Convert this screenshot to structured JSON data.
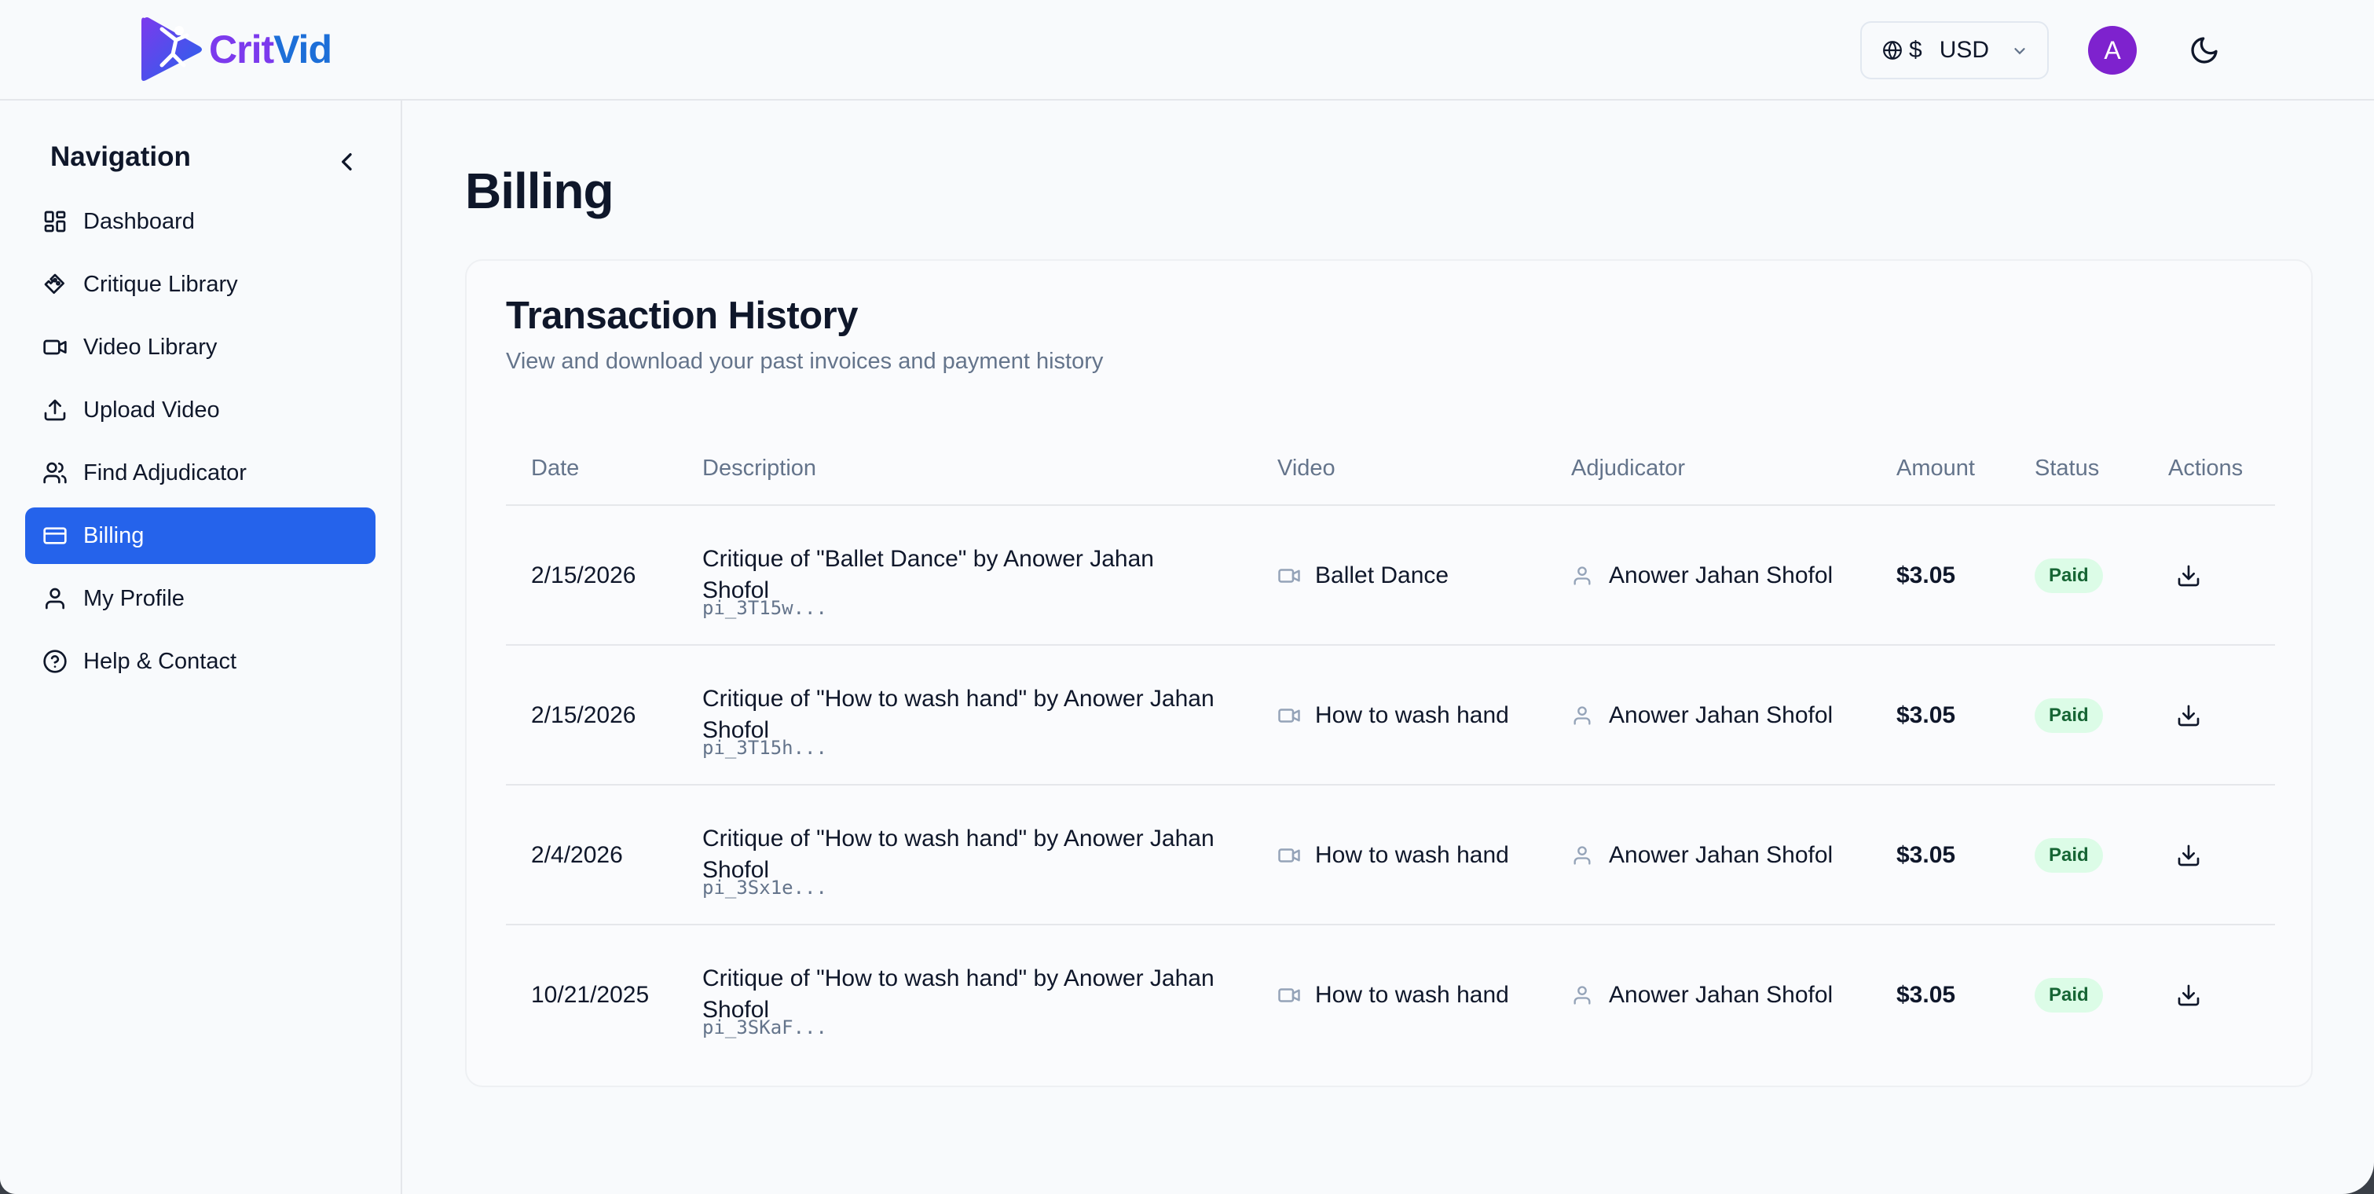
{
  "brand": {
    "name_part1": "Crit",
    "name_part2": "Vid",
    "color1": "#7c3aed",
    "color2": "#1d6fd8"
  },
  "header": {
    "currency": {
      "symbol": "$",
      "code": "USD"
    },
    "avatar_letter": "A",
    "avatar_color": "#7e22ce",
    "theme_icon": "moon-icon"
  },
  "sidebar": {
    "title": "Navigation",
    "items": [
      {
        "label": "Dashboard",
        "icon": "dashboard-icon",
        "active": false
      },
      {
        "label": "Critique Library",
        "icon": "palette-icon",
        "active": false
      },
      {
        "label": "Video Library",
        "icon": "video-icon",
        "active": false
      },
      {
        "label": "Upload Video",
        "icon": "upload-icon",
        "active": false
      },
      {
        "label": "Find Adjudicator",
        "icon": "users-icon",
        "active": false
      },
      {
        "label": "Billing",
        "icon": "credit-card-icon",
        "active": true
      },
      {
        "label": "My Profile",
        "icon": "user-icon",
        "active": false
      },
      {
        "label": "Help & Contact",
        "icon": "help-circle-icon",
        "active": false
      }
    ],
    "active_color": "#2563eb"
  },
  "page": {
    "title": "Billing"
  },
  "transactions": {
    "title": "Transaction History",
    "subtitle": "View and download your past invoices and payment history",
    "columns": [
      "Date",
      "Description",
      "Video",
      "Adjudicator",
      "Amount",
      "Status",
      "Actions"
    ],
    "rows": [
      {
        "date": "2/15/2026",
        "description": "Critique of \"Ballet Dance\" by Anower Jahan Shofol",
        "payment_id": "pi_3T15w...",
        "video": "Ballet Dance",
        "adjudicator": "Anower Jahan Shofol",
        "amount": "$3.05",
        "status": "Paid"
      },
      {
        "date": "2/15/2026",
        "description": "Critique of \"How to wash hand\" by Anower Jahan Shofol",
        "payment_id": "pi_3T15h...",
        "video": "How to wash hand",
        "adjudicator": "Anower Jahan Shofol",
        "amount": "$3.05",
        "status": "Paid"
      },
      {
        "date": "2/4/2026",
        "description": "Critique of \"How to wash hand\" by Anower Jahan Shofol",
        "payment_id": "pi_3Sx1e...",
        "video": "How to wash hand",
        "adjudicator": "Anower Jahan Shofol",
        "amount": "$3.05",
        "status": "Paid"
      },
      {
        "date": "10/21/2025",
        "description": "Critique of \"How to wash hand\" by Anower Jahan Shofol",
        "payment_id": "pi_3SKaF...",
        "video": "How to wash hand",
        "adjudicator": "Anower Jahan Shofol",
        "amount": "$3.05",
        "status": "Paid"
      }
    ],
    "status_color": "#166534",
    "status_bg": "#dcfce7"
  }
}
